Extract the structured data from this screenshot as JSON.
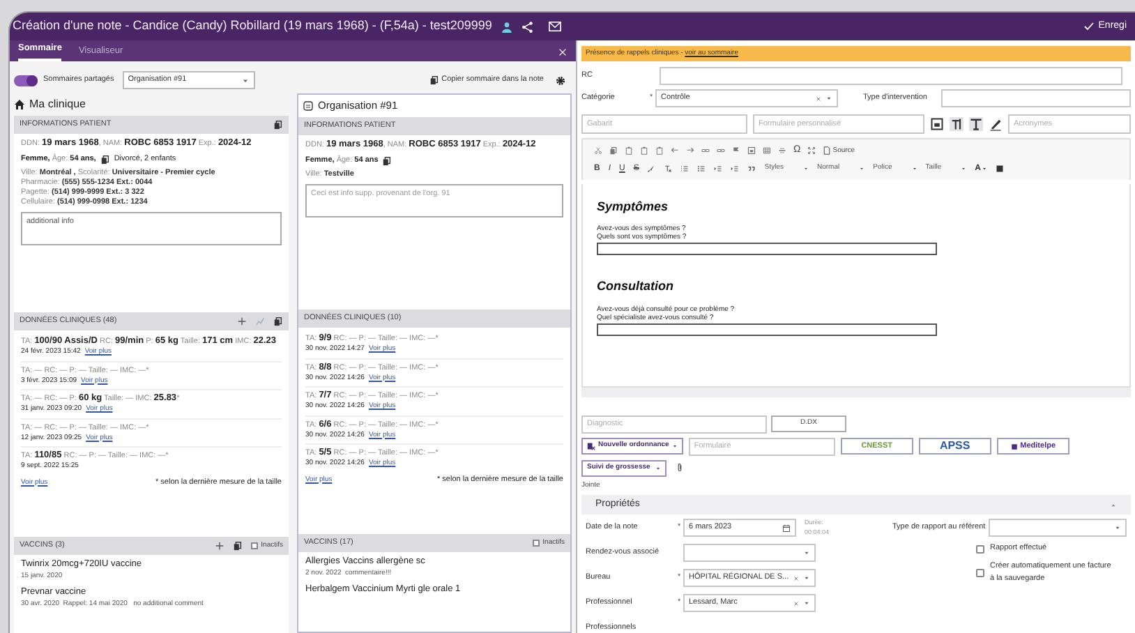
{
  "window": {
    "title": "Création d'une note - Candice (Candy) Robillard (19 mars 1968) - (F,54a) - test209999",
    "save_label": "Enregi"
  },
  "summary_panel": {
    "tabs": [
      {
        "label": "Sommaire",
        "selected": true
      },
      {
        "label": "Visualiseur",
        "selected": false
      }
    ],
    "shared_toggle": {
      "label": "Sommaires partagés",
      "on": true
    },
    "organisation_select": {
      "value": "Organisation #91"
    },
    "copy_label": "Copier sommaire dans la note",
    "columns": [
      {
        "kind": "home",
        "title": "Ma clinique",
        "patient": {
          "header": "INFORMATIONS PATIENT",
          "lines": [
            "DDN: **19 mars 1968**, NAM: **ROBC 6853 1917** Exp.: **2024-12**",
            "**Femme,** Âge: **54 ans,**",
            "Ville: **Montréal ,** Scolarité: **Universitaire - Premier cycle**\nPharmacie: **(555) 555-1234 Ext.: 0044**\nPagette: **(514) 999-9999 Ext.: 3 322**\nCellulaire: **(514) 999-0998 Ext.: 1234**"
          ],
          "family": "Divorcé, 2 enfants",
          "note": "additional info"
        },
        "clinical": {
          "header": "DONNÉES CLINIQUES (48)",
          "entries": [
            {
              "text": "TA: **100/90 Assis/D** RC: **99/min** P: **65 kg** Taille: **171 cm** IMC: **22.23**",
              "date": "24 févr. 2023 15:42",
              "link": "Voir plus"
            },
            {
              "text": "TA: — RC: — P: — Taille: — IMC: —*",
              "date": "3 févr. 2023 15:09",
              "link": "Voir plus"
            },
            {
              "text": "TA: — RC: — P: **60 kg** Taille: — IMC: **25.83**​*",
              "date": "31 janv. 2023 09:20",
              "link": "Voir plus"
            },
            {
              "text": "TA: — RC: — P: — Taille: — IMC: —*",
              "date": "12 janv. 2023 09:25",
              "link": "Voir plus"
            },
            {
              "text": "TA: **110/85** RC: — P: — Taille: — IMC: —*",
              "date": "9 sept. 2022 15:25"
            }
          ],
          "more_link": "Voir plus",
          "footnote": "* selon la dernière mesure de la taille"
        },
        "vaccines": {
          "header": "VACCINS (3)",
          "inactive": {
            "label": "Inactifs",
            "checked": false
          },
          "items": [
            {
              "name": "Twinrix 20mcg+720IU vaccine",
              "detail": "15 janv. 2020"
            },
            {
              "name": "Prevnar vaccine",
              "detail": "30 avr. 2020  Rappel: 14 mai 2020   no additional comment"
            }
          ]
        }
      },
      {
        "kind": "organisation",
        "title": "Organisation #91",
        "patient": {
          "header": "INFORMATIONS PATIENT",
          "lines": [
            "DDN: **19 mars 1968**, NAM: **ROBC 6853 1917** Exp.: **2024-12**",
            "**Femme,** Âge: **54 ans**",
            "Ville: **Testville**"
          ],
          "note": "Ceci est info supp. provenant de l'org. 91"
        },
        "clinical": {
          "header": "DONNÉES CLINIQUES (10)",
          "entries": [
            {
              "text": "TA: **9/9** RC: — P: — Taille: — IMC: —*",
              "date": "30 nov. 2022 14:27",
              "link": "Voir plus"
            },
            {
              "text": "TA: **8/8** RC: — P: — Taille: — IMC: —*",
              "date": "30 nov. 2022 14:26",
              "link": "Voir plus"
            },
            {
              "text": "TA: **7/7** RC: — P: — Taille: — IMC: —*",
              "date": "30 nov. 2022 14:26",
              "link": "Voir plus"
            },
            {
              "text": "TA: **6/6** RC: — P: — Taille: — IMC: —*",
              "date": "30 nov. 2022 14:26",
              "link": "Voir plus"
            },
            {
              "text": "TA: **5/5** RC: — P: — Taille: — IMC: —*",
              "date": "30 nov. 2022 14:26",
              "link": "Voir plus"
            }
          ],
          "more_link": "Voir plus",
          "footnote": "* selon la dernière mesure de la taille"
        },
        "vaccines": {
          "header": "VACCINS (17)",
          "inactive": {
            "label": "Inactifs",
            "checked": false
          },
          "items": [
            {
              "name": "Allergies Vaccins allergène sc",
              "detail": "2 nov. 2022  commentaire!!!"
            },
            {
              "name": "Herbalgem Vaccinium Myrti gle orale 1"
            }
          ]
        }
      }
    ]
  },
  "note_form": {
    "banner": {
      "text": "Présence de rappels cliniques - ",
      "link": "voir au sommaire"
    },
    "rc_label": "RC",
    "category": {
      "label": "Catégorie",
      "mark": "*",
      "value": "Contrôle"
    },
    "intervention_label": "Type d'intervention",
    "template_placeholder": "Gabarit",
    "custom_form_placeholder": "Formulaire personnalisé",
    "acronyms_placeholder": "Acronymes",
    "toolbar": {
      "omega": "Ω",
      "source_label": "Source",
      "format_buttons": [
        "B",
        "I",
        "U",
        "S"
      ],
      "dropdowns": [
        "Styles",
        "Normal",
        "Police",
        "Taille"
      ],
      "color_button": "A"
    },
    "document": [
      {
        "heading": "Symptômes",
        "questions": [
          "Avez-vous des symptômes ?",
          "Quels sont vos symptômes ?"
        ]
      },
      {
        "heading": "Consultation",
        "questions": [
          "Avez-vous déjà consulté pour ce problème ?",
          "Quel spécialiste avez-vous consulté ?"
        ]
      }
    ],
    "diagnosis": {
      "placeholder": "Diagnostic",
      "button": "D.DX"
    },
    "prescription_button": "Nouvelle ordonnance",
    "form_placeholder": "Formulaire",
    "logos": [
      {
        "label": "CNESST",
        "color": "#6a9a3a"
      },
      {
        "label": "APSS",
        "color": "#2a5aa8"
      },
      {
        "label": "Meditelpe",
        "color": "#4b2a8b"
      }
    ],
    "pregnancy_button": "Suivi de grossesse",
    "attachments_label": "Jointe",
    "properties": {
      "title": "Propriétés",
      "expanded": true,
      "date": {
        "label": "Date de la note",
        "mark": "*",
        "value": "6 mars 2023"
      },
      "duration": {
        "label": "Durée:",
        "value": "00:04:04"
      },
      "report_type_label": "Type de rapport au référent",
      "appointment_label": "Rendez-vous associé",
      "office": {
        "label": "Bureau",
        "mark": "*",
        "value": "HÔPITAL RÉGIONAL DE S..."
      },
      "professional": {
        "label": "Professionnel",
        "mark": "*",
        "value": "Lessard, Marc"
      },
      "professionals_label": "Professionnels",
      "checkboxes": [
        {
          "label": "Rapport effectué",
          "checked": false
        },
        {
          "label": "Créer automatiquement une facture\nà la sauvegarde",
          "checked": false
        }
      ]
    }
  }
}
